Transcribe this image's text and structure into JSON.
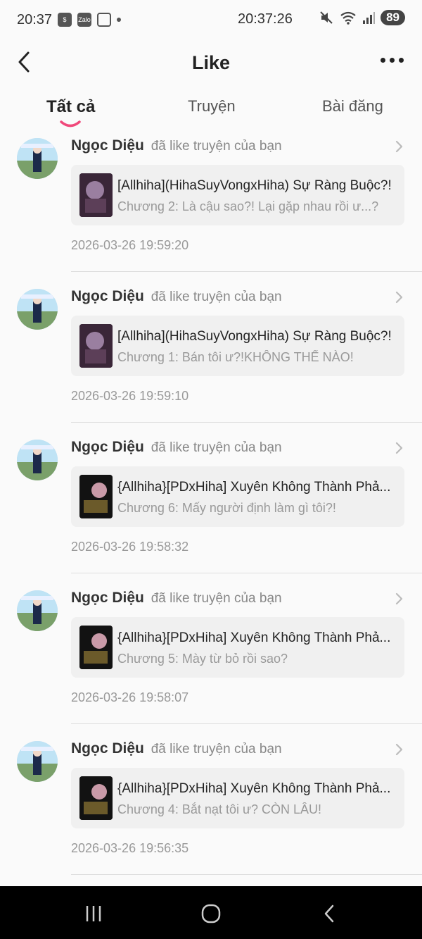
{
  "status_bar": {
    "time_left": "20:37",
    "clock": "20:37:26",
    "icons": [
      "shop-icon",
      "zalo-icon",
      "scan-icon",
      "dot-icon",
      "mute-icon",
      "wifi-icon",
      "signal-icon"
    ],
    "zalo_label": "Zalo",
    "battery": "89"
  },
  "header": {
    "title": "Like",
    "back_icon": "chevron-left-icon",
    "more_icon": "more-horizontal-icon"
  },
  "tabs": [
    {
      "label": "Tất cả",
      "active": true
    },
    {
      "label": "Truyện",
      "active": false
    },
    {
      "label": "Bài đăng",
      "active": false
    }
  ],
  "colors": {
    "accent": "#f0487a",
    "background": "#fafafa",
    "card": "#f0f0f0",
    "muted": "#999999"
  },
  "notifications": [
    {
      "user": "Ngọc Diệu",
      "action": "đã like truyện của bạn",
      "story": "[Allhiha](HihaSuyVongxHiha) Sự Ràng Buộc?!",
      "chapter": "Chương 2: Là cậu sao?! Lại gặp nhau rồi ư...?",
      "time": "2026-03-26 19:59:20"
    },
    {
      "user": "Ngọc Diệu",
      "action": "đã like truyện của bạn",
      "story": "[Allhiha](HihaSuyVongxHiha) Sự Ràng Buộc?!",
      "chapter": "Chương 1: Bán tôi ư?!KHÔNG THỂ NÀO!",
      "time": "2026-03-26 19:59:10"
    },
    {
      "user": "Ngọc Diệu",
      "action": "đã like truyện của bạn",
      "story": "{Allhiha}[PDxHiha] Xuyên Không Thành Phả...",
      "chapter": "Chương 6: Mấy người định làm gì tôi?!",
      "time": "2026-03-26 19:58:32"
    },
    {
      "user": "Ngọc Diệu",
      "action": "đã like truyện của bạn",
      "story": "{Allhiha}[PDxHiha] Xuyên Không Thành Phả...",
      "chapter": "Chương 5: Mày từ bỏ rồi sao?",
      "time": "2026-03-26 19:58:07"
    },
    {
      "user": "Ngọc Diệu",
      "action": "đã like truyện của bạn",
      "story": "{Allhiha}[PDxHiha] Xuyên Không Thành Phả...",
      "chapter": "Chương 4: Bắt nạt tôi ư? CÒN LÂU!",
      "time": "2026-03-26 19:56:35"
    }
  ],
  "nav_bar": {
    "icons": [
      "recent-apps-icon",
      "home-icon",
      "back-icon"
    ]
  }
}
